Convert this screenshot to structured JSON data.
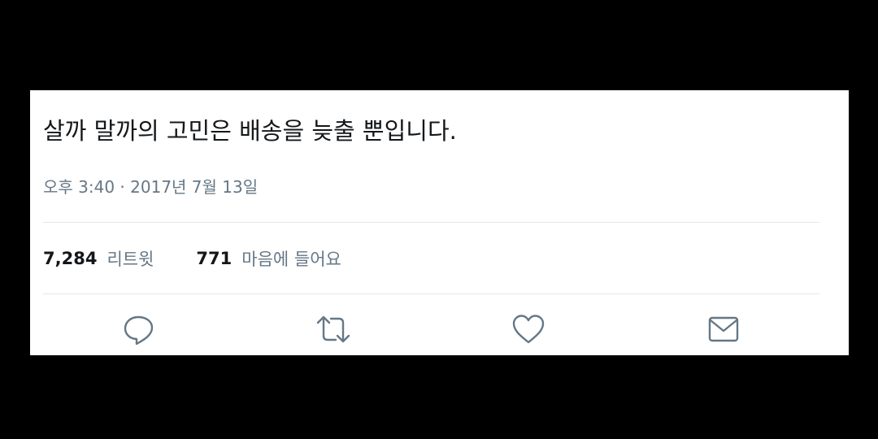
{
  "tweet": {
    "text": "살까 말까의 고민은 배송을 늦출 뿐입니다.",
    "timestamp": "오후 3:40 · 2017년 7월 13일"
  },
  "stats": {
    "retweets_count": "7,284",
    "retweets_label": "리트윗",
    "likes_count": "771",
    "likes_label": "마음에 들어요"
  },
  "actions": [
    {
      "icon": "reply-icon"
    },
    {
      "icon": "retweet-icon"
    },
    {
      "icon": "heart-icon"
    },
    {
      "icon": "mail-icon"
    }
  ],
  "colors": {
    "background": "#000000",
    "card": "#ffffff",
    "text": "#14171a",
    "secondary": "#657786",
    "divider": "#e1e8ed"
  }
}
